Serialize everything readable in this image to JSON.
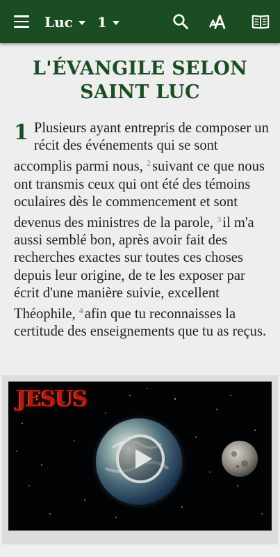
{
  "header": {
    "book": "Luc",
    "chapter": "1",
    "icons": [
      "menu-icon",
      "search-icon",
      "text-size-icon",
      "parallel-book-icon"
    ]
  },
  "colors": {
    "header_bg": "#1b4d22",
    "title": "#1b4d22",
    "verse_number": "#4e9a56",
    "background": "#eeeeee"
  },
  "passage": {
    "title": "L'ÉVANGILE SELON SAINT LUC",
    "chapter_number": "1",
    "verses": [
      {
        "num": "",
        "text": "Plusieurs ayant entrepris de composer un récit des événements qui se sont accomplis parmi nous, "
      },
      {
        "num": "2",
        "text": "suivant ce que nous ont transmis ceux qui ont été des témoins oculaires dès le commencement et sont devenus des ministres de la parole, "
      },
      {
        "num": "3",
        "text": "il m'a aussi semblé bon, après avoir fait des recherches exactes sur toutes ces choses depuis leur origine, de te les exposer par écrit d'une manière suivie, excellent Théophile, "
      },
      {
        "num": "4",
        "text": "afin que tu reconnaisses la certitude des enseignements que tu as reçus."
      }
    ]
  },
  "video": {
    "logo_text": "JESUS",
    "icon": "play-icon"
  }
}
